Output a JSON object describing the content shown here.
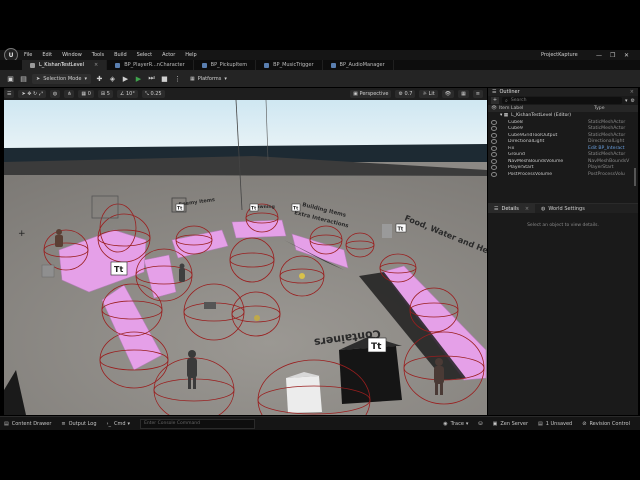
{
  "app": {
    "project_name": "ProjectKapture",
    "logo_icon": "unreal-logo-icon",
    "window_controls": [
      "—",
      "❐",
      "✕"
    ]
  },
  "menu": [
    "File",
    "Edit",
    "Window",
    "Tools",
    "Build",
    "Select",
    "Actor",
    "Help"
  ],
  "tabs": [
    {
      "label": "L_KishanTestLevel",
      "active": true
    },
    {
      "label": "BP_PlayerR...nCharacter",
      "active": false
    },
    {
      "label": "BP_PickupItem",
      "active": false
    },
    {
      "label": "BP_MusicTrigger",
      "active": false
    },
    {
      "label": "BP_AudioManager",
      "active": false
    }
  ],
  "toolbar": {
    "mode_label": "Selection Mode",
    "platforms_label": "Platforms"
  },
  "viewport_toolbar": {
    "snap_rotate": "10°",
    "snap_scale": "0.25",
    "perspective_label": "Perspective",
    "lit_label": "Lit",
    "fov_value": "0.7",
    "translate_snap": "0",
    "grid_value": "5"
  },
  "scene_labels": {
    "enemy_items": "Enemy Items",
    "spawning": "Spawning",
    "building_items": "Building Items",
    "extra_interactions": "Extra Interactions",
    "food_water_health": "Food, Water and Health It",
    "containers": "Containers",
    "text_actor_glyph": "Tt"
  },
  "outliner": {
    "tab_label": "Outliner",
    "search_placeholder": "Search",
    "col_item_label": "Item Label",
    "col_type": "Type",
    "level_row": "L_KishanTestLevel (Editor)",
    "rows": [
      {
        "name": "Cube8",
        "type": "StaticMeshActor",
        "link": false
      },
      {
        "name": "Cube9",
        "type": "StaticMeshActor",
        "link": false
      },
      {
        "name": "Cube9GridToolOutput",
        "type": "StaticMeshActor",
        "link": false
      },
      {
        "name": "DirectionalLight",
        "type": "DirectionalLight",
        "link": false
      },
      {
        "name": "Fix",
        "type": "Edit BP_Interact",
        "link": true
      },
      {
        "name": "Ground",
        "type": "StaticMeshActor",
        "link": false
      },
      {
        "name": "NavMeshBoundsVolume",
        "type": "NavMeshBoundsV",
        "link": false
      },
      {
        "name": "PlayerStart",
        "type": "PlayerStart",
        "link": false
      },
      {
        "name": "PostProcessVolume",
        "type": "PostProcessVolu",
        "link": false
      }
    ]
  },
  "details": {
    "details_tab": "Details",
    "world_settings_tab": "World Settings",
    "empty_message": "Select an object to view details."
  },
  "statusbar": {
    "content_drawer": "Content Drawer",
    "output_log": "Output Log",
    "cmd_label": "Cmd",
    "cmd_placeholder": "Enter Console Command",
    "trace": "Trace",
    "derived_data": "",
    "zen_server": "Zen Server",
    "unsaved": "1 Unsaved",
    "revision_control": "Revision Control"
  },
  "colors": {
    "accent_play": "#3fa34d",
    "link_blue": "#6aa0e0",
    "pink_blocks": "#e5a0e8",
    "trigger_red": "#9a1e1e",
    "sky_top": "#cfe7f2",
    "ground": "#8c8985"
  }
}
